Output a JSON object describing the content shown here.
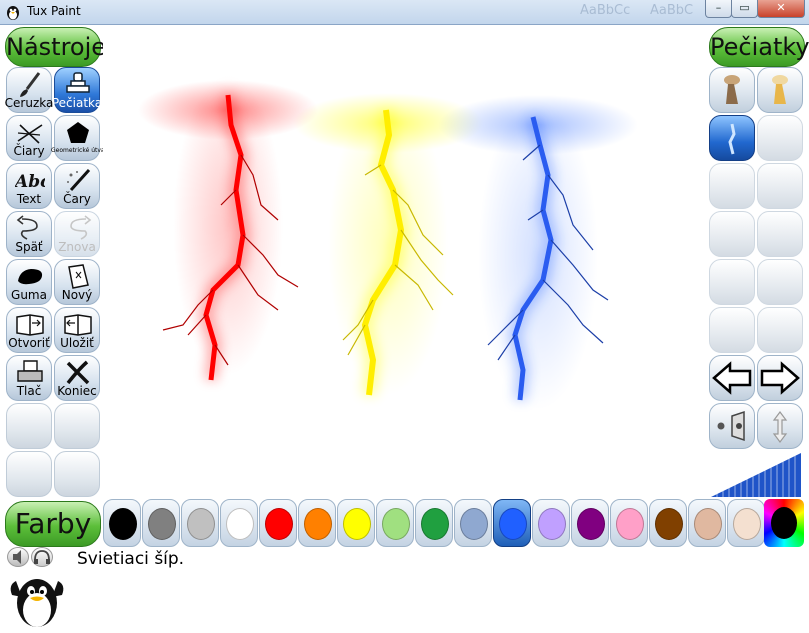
{
  "window": {
    "title": "Tux Paint",
    "background_tab_text_1": "AaBbCc",
    "background_tab_text_2": "AaBbC"
  },
  "tools_panel": {
    "heading": "Nástroje",
    "tools": [
      {
        "label": "Ceruzka",
        "icon": "paintbrush-icon",
        "active": false
      },
      {
        "label": "Pečiatka",
        "icon": "stamp-icon",
        "active": true
      },
      {
        "label": "Čiary",
        "icon": "lines-icon",
        "active": false
      },
      {
        "label": "Geometrické útvary",
        "icon": "pentagon-icon",
        "active": false
      },
      {
        "label": "Text",
        "icon": "text-abc-icon",
        "active": false
      },
      {
        "label": "Čary",
        "icon": "magic-wand-icon",
        "active": false
      },
      {
        "label": "Späť",
        "icon": "undo-icon",
        "active": false
      },
      {
        "label": "Znova",
        "icon": "redo-icon",
        "active": false,
        "disabled": true
      },
      {
        "label": "Guma",
        "icon": "eraser-icon",
        "active": false
      },
      {
        "label": "Nový",
        "icon": "new-page-icon",
        "active": false
      },
      {
        "label": "Otvoriť",
        "icon": "open-book-icon",
        "active": false
      },
      {
        "label": "Uložiť",
        "icon": "save-book-icon",
        "active": false
      },
      {
        "label": "Tlač",
        "icon": "printer-icon",
        "active": false
      },
      {
        "label": "Koniec",
        "icon": "quit-x-icon",
        "active": false
      }
    ]
  },
  "stamps_panel": {
    "heading": "Pečiatky",
    "stamps": [
      {
        "name": "stamp-figure-brown",
        "selected": false
      },
      {
        "name": "stamp-figure-gold",
        "selected": false
      },
      {
        "name": "stamp-lightning-selected",
        "selected": true
      }
    ],
    "nav": {
      "prev_icon": "arrow-left-icon",
      "next_icon": "arrow-right-icon"
    },
    "sound_toggle_icon": "stamp-sound-icon",
    "flip_icon": "flip-vertical-icon",
    "size_slider_icon": "size-ramp-icon"
  },
  "colors_panel": {
    "heading": "Farby",
    "selected_index": 10,
    "colors": [
      "#000000",
      "#808080",
      "#c0c0c0",
      "#ffffff",
      "#ff0000",
      "#ff8000",
      "#ffff00",
      "#a0e080",
      "#20a040",
      "#8fa8d0",
      "#2060ff",
      "#c0a0ff",
      "#800080",
      "#ffa0c8",
      "#804000",
      "#e0b8a0",
      "#f4e0d0"
    ],
    "color_picker_icon": "rainbow-picker-icon"
  },
  "status_bar": {
    "message": "Svietiaci šíp.",
    "icons": [
      "speaker-icon",
      "headphones-icon"
    ],
    "mascot": "tux-penguin-icon"
  },
  "canvas": {
    "stamps_on_canvas": [
      {
        "name": "red-lightning-bolt",
        "color": "#ff0000"
      },
      {
        "name": "yellow-lightning-bolt",
        "color": "#ffff00"
      },
      {
        "name": "blue-lightning-bolt",
        "color": "#2060ff"
      }
    ]
  }
}
